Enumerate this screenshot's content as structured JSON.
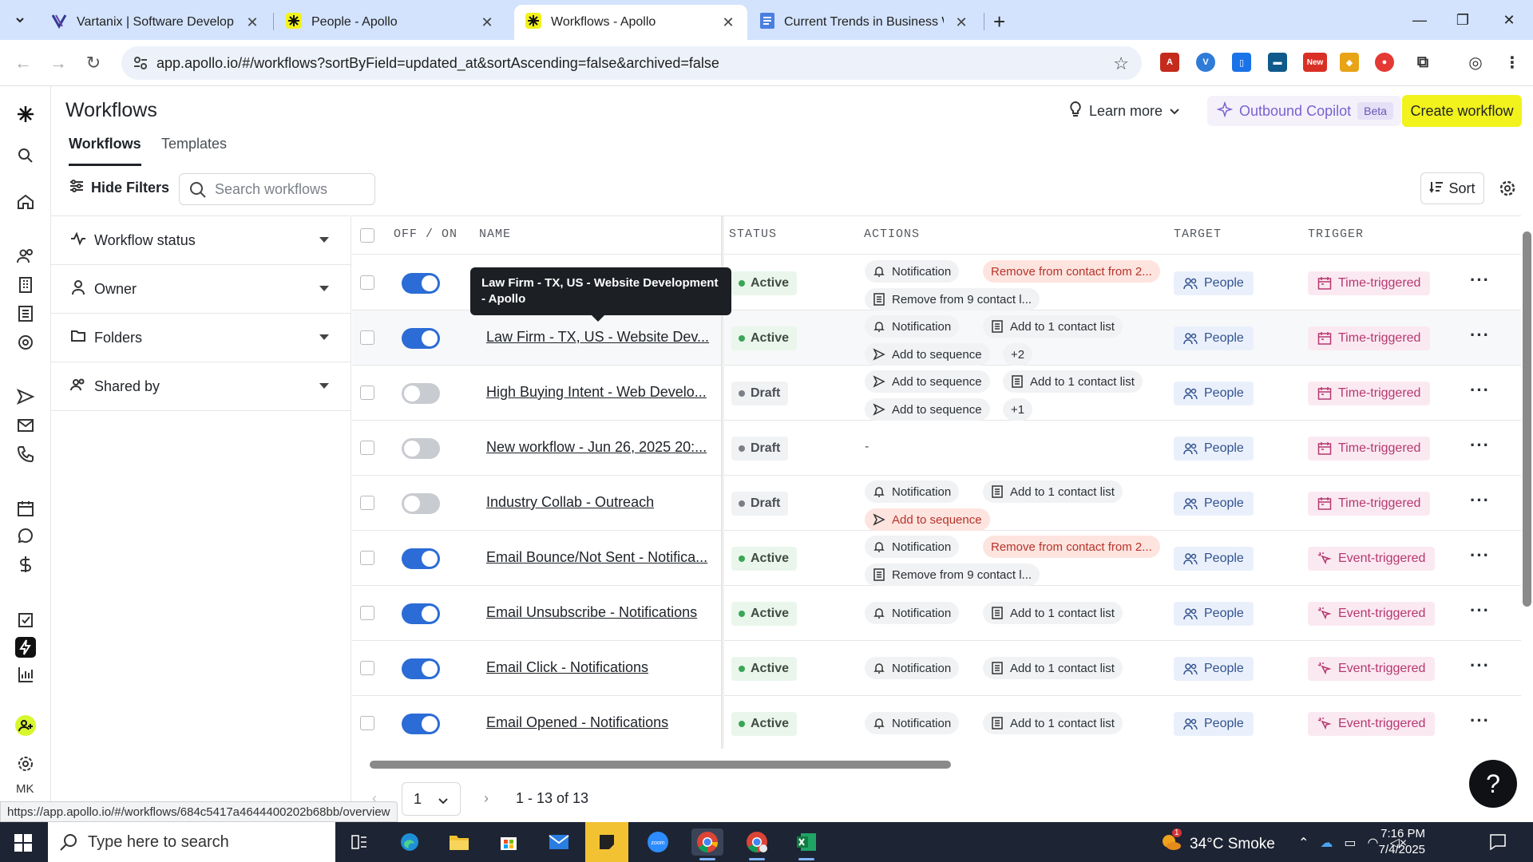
{
  "browser": {
    "tabs": [
      {
        "title": "Vartanix | Software Development",
        "icon": "vartanix-icon"
      },
      {
        "title": "People - Apollo",
        "icon": "apollo-icon"
      },
      {
        "title": "Workflows - Apollo",
        "icon": "apollo-icon",
        "active": true
      },
      {
        "title": "Current Trends in Business Web",
        "icon": "docs-icon"
      }
    ],
    "new_tab_label": "+",
    "url": "app.apollo.io/#/workflows?sortByField=updated_at&sortAscending=false&archived=false",
    "extension_badge": "New",
    "link_preview": "https://app.apollo.io/#/workflows/684c5417a4644400202b68bb/overview"
  },
  "header": {
    "title": "Workflows",
    "tabs": [
      {
        "label": "Workflows",
        "active": true
      },
      {
        "label": "Templates",
        "active": false
      }
    ],
    "learn_more": "Learn more",
    "copilot_label": "Outbound Copilot",
    "copilot_badge": "Beta",
    "create_label": "Create workflow"
  },
  "filter_bar": {
    "hide_filters": "Hide Filters",
    "search_placeholder": "Search workflows",
    "sort_label": "Sort"
  },
  "filters": [
    {
      "label": "Workflow status",
      "icon": "activity-icon"
    },
    {
      "label": "Owner",
      "icon": "user-icon"
    },
    {
      "label": "Folders",
      "icon": "folder-icon"
    },
    {
      "label": "Shared by",
      "icon": "users-icon"
    }
  ],
  "table": {
    "headers": {
      "toggle": "OFF / ON",
      "name": "NAME",
      "status": "STATUS",
      "actions": "ACTIONS",
      "target": "TARGET",
      "trigger": "TRIGGER"
    },
    "rows": [
      {
        "on": true,
        "name": "Law Firm - TX, US - Website Dev...",
        "status": "Active",
        "actions": [
          [
            {
              "label": "Notification",
              "icon": "bell-icon"
            },
            {
              "label": "Remove from contact from 2...",
              "icon": "",
              "warn": true
            }
          ],
          [
            {
              "label": "Remove from 9 contact l...",
              "icon": "list-icon"
            }
          ]
        ],
        "target": "People",
        "trigger": "Time-triggered",
        "trigger_icon": "calendar-icon"
      },
      {
        "on": true,
        "name": "Law Firm - TX, US - Website Dev...",
        "status": "Active",
        "actions": [
          [
            {
              "label": "Notification",
              "icon": "bell-icon"
            },
            {
              "label": "Add to 1 contact list",
              "icon": "list-icon"
            }
          ],
          [
            {
              "label": "Add to sequence",
              "icon": "send-icon"
            },
            {
              "label": "+2",
              "icon": ""
            }
          ]
        ],
        "target": "People",
        "trigger": "Time-triggered",
        "trigger_icon": "calendar-icon"
      },
      {
        "on": false,
        "name": "High Buying Intent - Web Develo...",
        "status": "Draft",
        "actions": [
          [
            {
              "label": "Add to sequence",
              "icon": "send-icon"
            },
            {
              "label": "Add to 1 contact list",
              "icon": "list-icon"
            }
          ],
          [
            {
              "label": "Add to sequence",
              "icon": "send-icon"
            },
            {
              "label": "+1",
              "icon": ""
            }
          ]
        ],
        "target": "People",
        "trigger": "Time-triggered",
        "trigger_icon": "calendar-icon"
      },
      {
        "on": false,
        "name": "New workflow - Jun 26, 2025 20:...",
        "status": "Draft",
        "actions": [],
        "empty_actions": "-",
        "target": "People",
        "trigger": "Time-triggered",
        "trigger_icon": "calendar-icon"
      },
      {
        "on": false,
        "name": "Industry Collab - Outreach",
        "status": "Draft",
        "actions": [
          [
            {
              "label": "Notification",
              "icon": "bell-icon"
            },
            {
              "label": "Add to 1 contact list",
              "icon": "list-icon"
            }
          ],
          [
            {
              "label": "Add to sequence",
              "icon": "send-icon",
              "warn": true
            }
          ]
        ],
        "target": "People",
        "trigger": "Time-triggered",
        "trigger_icon": "calendar-icon"
      },
      {
        "on": true,
        "name": "Email Bounce/Not Sent - Notifica...",
        "status": "Active",
        "actions": [
          [
            {
              "label": "Notification",
              "icon": "bell-icon"
            },
            {
              "label": "Remove from contact from 2...",
              "icon": "",
              "warn": true
            }
          ],
          [
            {
              "label": "Remove from 9 contact l...",
              "icon": "list-icon"
            }
          ]
        ],
        "target": "People",
        "trigger": "Event-triggered",
        "trigger_icon": "cursor-click-icon"
      },
      {
        "on": true,
        "name": "Email Unsubscribe - Notifications",
        "status": "Active",
        "actions": [
          [
            {
              "label": "Notification",
              "icon": "bell-icon"
            },
            {
              "label": "Add to 1 contact list",
              "icon": "list-icon"
            }
          ]
        ],
        "target": "People",
        "trigger": "Event-triggered",
        "trigger_icon": "cursor-click-icon"
      },
      {
        "on": true,
        "name": "Email Click - Notifications",
        "status": "Active",
        "actions": [
          [
            {
              "label": "Notification",
              "icon": "bell-icon"
            },
            {
              "label": "Add to 1 contact list",
              "icon": "list-icon"
            }
          ]
        ],
        "target": "People",
        "trigger": "Event-triggered",
        "trigger_icon": "cursor-click-icon"
      },
      {
        "on": true,
        "name": "Email Opened - Notifications",
        "status": "Active",
        "actions": [
          [
            {
              "label": "Notification",
              "icon": "bell-icon"
            },
            {
              "label": "Add to 1 contact list",
              "icon": "list-icon"
            }
          ]
        ],
        "target": "People",
        "trigger": "Event-triggered",
        "trigger_icon": "cursor-click-icon"
      }
    ]
  },
  "tooltip": "Law Firm - TX, US - Website Development - Apollo",
  "pagination": {
    "page": "1",
    "range": "1 - 13 of 13"
  },
  "rail": {
    "user_initials": "MK"
  },
  "taskbar": {
    "search_placeholder": "Type here to search",
    "weather": "34°C  Smoke",
    "time": "7:16 PM",
    "date": "7/4/2025",
    "weather_badge": "1"
  },
  "colors": {
    "accent_yellow": "#f2f21c",
    "toggle_on": "#2b6cd6",
    "active_green": "#3aa655",
    "warn_red": "#b6332a",
    "trigger_pink": "#b5386f",
    "target_blue": "#31528f"
  }
}
